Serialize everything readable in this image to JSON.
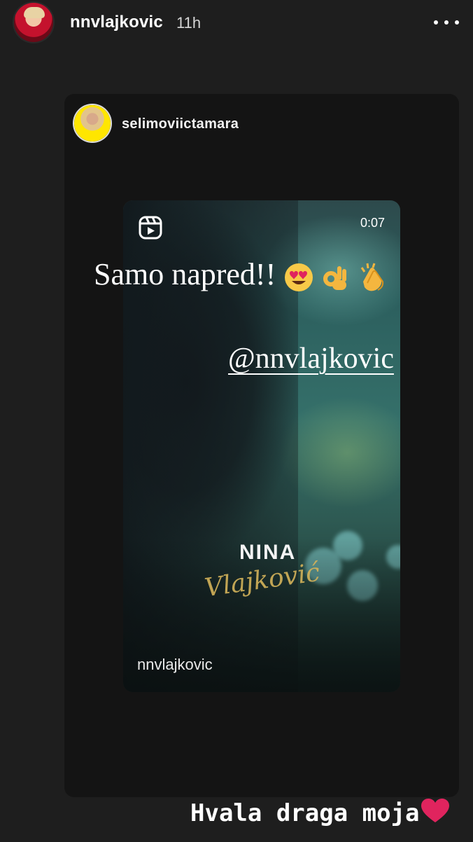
{
  "header": {
    "username": "nnvlajkovic",
    "time": "11h",
    "more_icon": "more-horizontal-icon"
  },
  "shared_story": {
    "username": "selimoviictamara",
    "caption_text": "Samo napred!!",
    "caption_emojis": [
      "heart-eyes-face",
      "ok-hand",
      "clapping-hands"
    ],
    "mention": "@nnvlajkovic"
  },
  "reel": {
    "icon": "reels-icon",
    "duration": "0:07",
    "title_text": "NINA",
    "title_script": "Vlajković",
    "owner": "nnvlajkovic"
  },
  "reply_text": "Hvala draga moja",
  "reply_emoji": "red-heart",
  "colors": {
    "background": "#1e1e1e",
    "card": "#141414",
    "accent_gold": "#d4b35a",
    "heart": "#e0245e"
  }
}
